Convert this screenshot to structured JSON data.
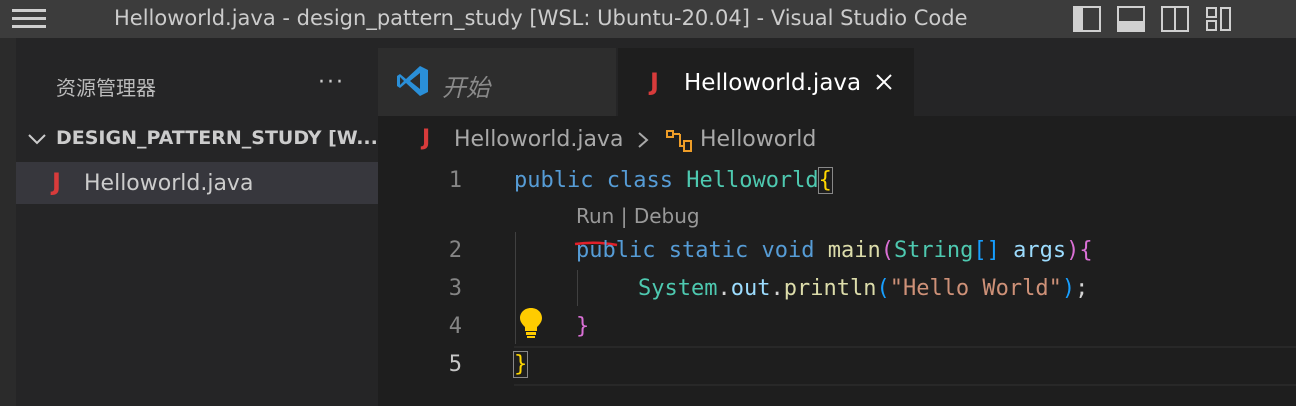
{
  "window": {
    "title": "Helloworld.java - design_pattern_study [WSL: Ubuntu-20.04] - Visual Studio Code"
  },
  "sidebar": {
    "title": "资源管理器",
    "more": "···",
    "folder": "DESIGN_PATTERN_STUDY [W...",
    "files": [
      {
        "icon": "J",
        "label": "Helloworld.java"
      }
    ]
  },
  "tabs": [
    {
      "label": "开始",
      "icon": "vscode-logo-icon"
    },
    {
      "label": "Helloworld.java",
      "icon": "J",
      "active": true
    }
  ],
  "breadcrumb": {
    "icon": "J",
    "file": "Helloworld.java",
    "symbol": "Helloworld"
  },
  "editor": {
    "line_numbers": [
      "1",
      "2",
      "3",
      "4",
      "5"
    ],
    "codelens": {
      "run": "Run",
      "separator": " | ",
      "debug": "Debug"
    },
    "lines": {
      "l1": {
        "kw1": "public",
        "kw2": "class",
        "cls": "Helloworld",
        "brace": "{"
      },
      "l2": {
        "kw1": "public",
        "kw2": "static",
        "kw3": "void",
        "fn": "main",
        "open": "(",
        "type": "String",
        "brackets": "[]",
        "param": "args",
        "close": ")",
        "brace": "{"
      },
      "l3": {
        "cls": "System",
        "dot1": ".",
        "field": "out",
        "dot2": ".",
        "fn": "println",
        "open": "(",
        "str": "\"Hello World\"",
        "close": ")",
        "semi": ";"
      },
      "l4": {
        "brace": "}"
      },
      "l5": {
        "brace": "}"
      }
    }
  },
  "colors": {
    "keyword": "#569cd6",
    "class": "#4ec9b0",
    "function": "#dcdcaa",
    "string": "#ce9178",
    "java_icon": "#d83b3b",
    "underline_annotation": "#e0202a"
  }
}
